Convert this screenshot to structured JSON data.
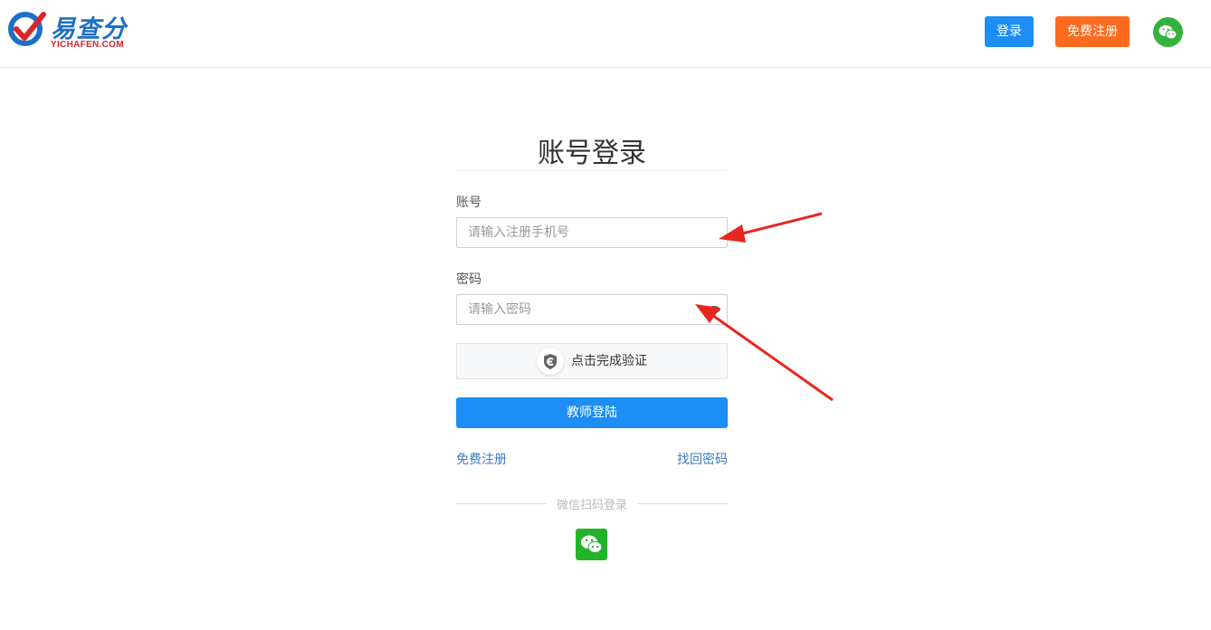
{
  "header": {
    "logo_cn": "易查分",
    "logo_en": "YICHAFEN.COM",
    "login_label": "登录",
    "register_label": "免费注册"
  },
  "form": {
    "title": "账号登录",
    "account_label": "账号",
    "account_placeholder": "请输入注册手机号",
    "password_label": "密码",
    "password_placeholder": "请输入密码",
    "captcha_text": "点击完成验证",
    "submit_label": "教师登陆",
    "register_link": "免费注册",
    "forgot_link": "找回密码",
    "wechat_divider": "微信扫码登录"
  },
  "colors": {
    "primary": "#1c8ef5",
    "orange": "#fd6b1e",
    "wechat": "#23b32b",
    "arrow": "#e8261f"
  },
  "icons": [
    "wechat-icon",
    "eye-icon",
    "shield-verify-icon",
    "annotation-arrow"
  ]
}
